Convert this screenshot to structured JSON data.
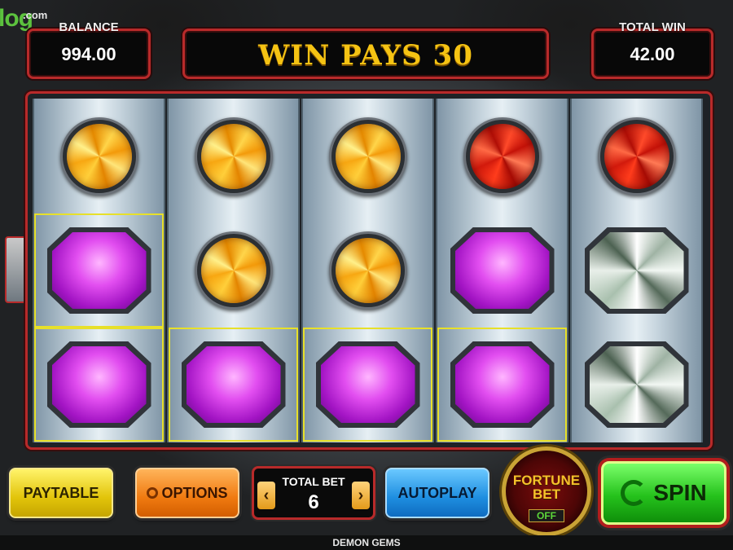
{
  "brand": {
    "logo_text": "log",
    "logo_suffix": ".com"
  },
  "header": {
    "balance_label": "BALANCE",
    "balance_value": "994.00",
    "win_message": "WIN PAYS 30",
    "total_win_label": "TOTAL WIN",
    "total_win_value": "42.00"
  },
  "reels": [
    [
      "orange-gem",
      "purple-gem",
      "purple-gem"
    ],
    [
      "orange-gem",
      "orange-gem",
      "purple-gem"
    ],
    [
      "orange-gem",
      "orange-gem",
      "purple-gem"
    ],
    [
      "red-gem",
      "purple-gem",
      "purple-gem"
    ],
    [
      "red-gem",
      "white-diamond",
      "white-diamond"
    ]
  ],
  "winning_cells": [
    [
      0,
      1
    ],
    [
      0,
      2
    ],
    [
      1,
      2
    ],
    [
      2,
      2
    ],
    [
      3,
      2
    ]
  ],
  "controls": {
    "paytable_label": "PAYTABLE",
    "options_label": "OPTIONS",
    "total_bet_label": "TOTAL BET",
    "total_bet_value": "6",
    "bet_minus": "‹",
    "bet_plus": "›",
    "autoplay_label": "AUTOPLAY",
    "fortune_bet_line1": "FORTUNE",
    "fortune_bet_line2": "BET",
    "fortune_bet_state": "OFF",
    "spin_label": "SPIN"
  },
  "footer": {
    "game_name": "DEMON GEMS"
  },
  "colors": {
    "frame_red": "#b82a2a",
    "win_gold": "#f5c313",
    "highlight_yellow": "#e7e02a",
    "spin_green": "#25c21c"
  }
}
